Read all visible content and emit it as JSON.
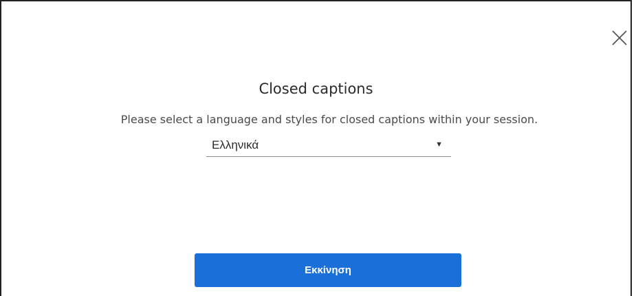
{
  "dialog": {
    "title": "Closed captions",
    "description": "Please select a language and styles for closed captions within your session.",
    "close_icon": "close-icon"
  },
  "language_select": {
    "selected": "Ελληνικά",
    "caret_icon": "caret-down-icon",
    "caret_glyph": "▼"
  },
  "start_button": {
    "label": "Εκκίνηση",
    "color": "#1a6fd8"
  }
}
